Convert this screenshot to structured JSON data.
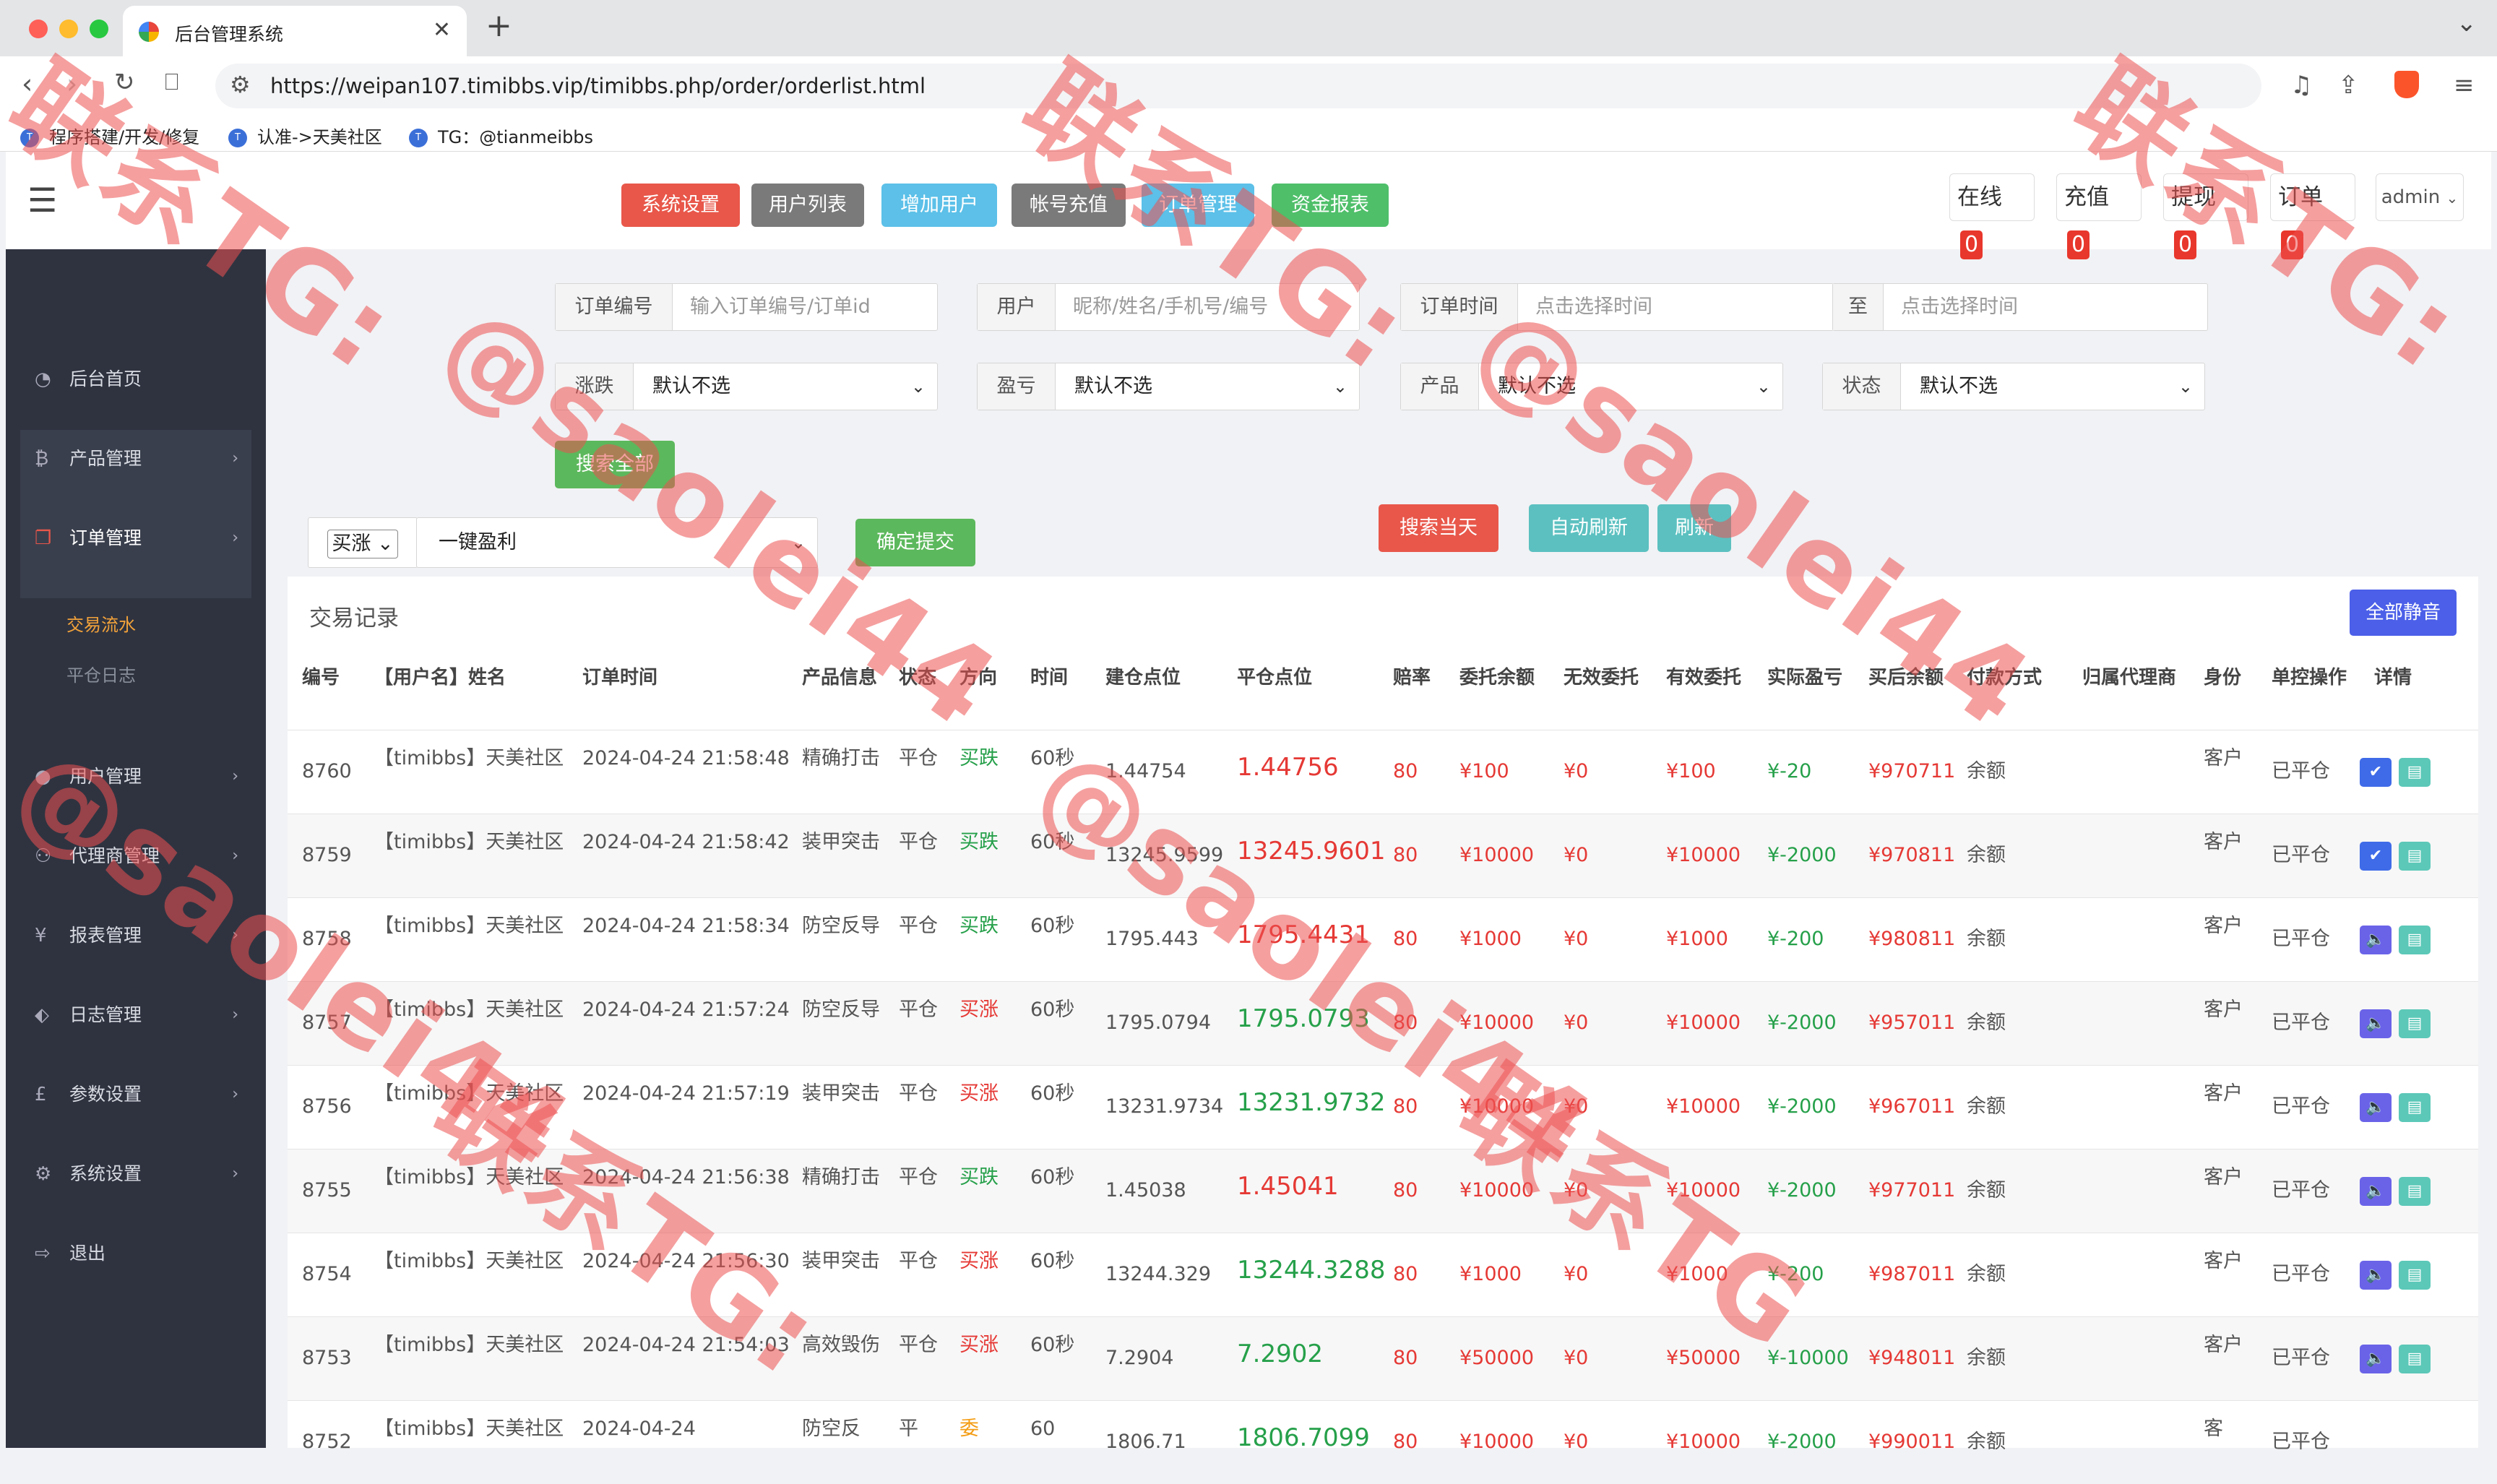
{
  "browser": {
    "tab_title": "后台管理系统",
    "tab_close": "✕",
    "new_tab": "+",
    "url": "https://weipan107.timibbs.vip/timibbs.php/order/orderlist.html",
    "bookmarks": [
      "程序搭建/开发/修复",
      "认准->天美社区",
      "TG：@tianmeibbs"
    ]
  },
  "topnav": {
    "buttons": [
      "系统设置",
      "用户列表",
      "增加用户",
      "帐号充值",
      "订单管理",
      "资金报表"
    ],
    "button_colors": [
      "#e8574a",
      "#7a7a7a",
      "#5cc0e8",
      "#7a7a7a",
      "#5cc0e8",
      "#4fbf6a"
    ],
    "stats": [
      {
        "label": "在线",
        "count": "0"
      },
      {
        "label": "充值",
        "count": "0"
      },
      {
        "label": "提现",
        "count": "0"
      },
      {
        "label": "订单",
        "count": "0"
      }
    ],
    "admin": "admin"
  },
  "sidebar": {
    "items": [
      {
        "label": "后台首页",
        "icon": "dashboard-icon",
        "glyph": "◔"
      },
      {
        "label": "产品管理",
        "icon": "bitcoin-icon",
        "glyph": "₿"
      },
      {
        "label": "订单管理",
        "icon": "copy-icon",
        "glyph": "❐"
      },
      {
        "label": "用户管理",
        "icon": "user-icon",
        "glyph": "●"
      },
      {
        "label": "代理商管理",
        "icon": "sitemap-icon",
        "glyph": "⚇"
      },
      {
        "label": "报表管理",
        "icon": "yen-icon",
        "glyph": "¥"
      },
      {
        "label": "日志管理",
        "icon": "tag-icon",
        "glyph": "⬖"
      },
      {
        "label": "参数设置",
        "icon": "pound-icon",
        "glyph": "£"
      },
      {
        "label": "系统设置",
        "icon": "gears-icon",
        "glyph": "⚙"
      },
      {
        "label": "退出",
        "icon": "signout-icon",
        "glyph": "⇨"
      }
    ],
    "submenu": [
      "交易流水",
      "平仓日志"
    ]
  },
  "filters": {
    "order_no": {
      "label": "订单编号",
      "placeholder": "输入订单编号/订单id"
    },
    "user": {
      "label": "用户",
      "placeholder": "昵称/姓名/手机号/编号"
    },
    "order_time": {
      "label": "订单时间",
      "placeholder": "点击选择时间"
    },
    "to": {
      "label": "至",
      "placeholder": "点击选择时间"
    },
    "rise_fall": {
      "label": "涨跌",
      "value": "默认不选"
    },
    "profit": {
      "label": "盈亏",
      "value": "默认不选"
    },
    "product": {
      "label": "产品",
      "value": "默认不选"
    },
    "status": {
      "label": "状态",
      "value": "默认不选"
    },
    "search_all": "搜索全部"
  },
  "actions": {
    "direction_select": "买涨",
    "profit_select": "一键盈利",
    "submit": "确定提交",
    "search_today": "搜索当天",
    "auto_refresh": "自动刷新",
    "refresh": "刷新"
  },
  "table": {
    "title": "交易记录",
    "mute_all": "全部静音",
    "headers": [
      "编号",
      "【用户名】姓名",
      "订单时间",
      "产品信息",
      "状态",
      "方向",
      "时间",
      "建仓点位",
      "平仓点位",
      "赔率",
      "委托余额",
      "无效委托",
      "有效委托",
      "实际盈亏",
      "买后余额",
      "付款方式",
      "归属代理商",
      "身份",
      "单控操作",
      "详情"
    ],
    "rows": [
      {
        "id": "8760",
        "user": "【timibbs】天美社区",
        "time": "2024-04-24 21:58:48",
        "product": "精确打击",
        "status": "平仓",
        "dir": "买跌",
        "dur": "60秒",
        "open": "1.44754",
        "close": "1.44756",
        "close_color": "red",
        "odds": "80",
        "entrust": "¥100",
        "invalid": "¥0",
        "valid": "¥100",
        "pl": "¥-20",
        "balance": "¥970711",
        "pay": "余额",
        "agent": "",
        "role": "客户",
        "ctrl": "已平仓",
        "op": "check"
      },
      {
        "id": "8759",
        "user": "【timibbs】天美社区",
        "time": "2024-04-24 21:58:42",
        "product": "装甲突击",
        "status": "平仓",
        "dir": "买跌",
        "dur": "60秒",
        "open": "13245.9599",
        "close": "13245.9601",
        "close_color": "red",
        "odds": "80",
        "entrust": "¥10000",
        "invalid": "¥0",
        "valid": "¥10000",
        "pl": "¥-2000",
        "balance": "¥970811",
        "pay": "余额",
        "agent": "",
        "role": "客户",
        "ctrl": "已平仓",
        "op": "check"
      },
      {
        "id": "8758",
        "user": "【timibbs】天美社区",
        "time": "2024-04-24 21:58:34",
        "product": "防空反导",
        "status": "平仓",
        "dir": "买跌",
        "dur": "60秒",
        "open": "1795.443",
        "close": "1795.4431",
        "close_color": "red",
        "odds": "80",
        "entrust": "¥1000",
        "invalid": "¥0",
        "valid": "¥1000",
        "pl": "¥-200",
        "balance": "¥980811",
        "pay": "余额",
        "agent": "",
        "role": "客户",
        "ctrl": "已平仓",
        "op": "sound"
      },
      {
        "id": "8757",
        "user": "【timibbs】天美社区",
        "time": "2024-04-24 21:57:24",
        "product": "防空反导",
        "status": "平仓",
        "dir": "买涨",
        "dur": "60秒",
        "open": "1795.0794",
        "close": "1795.0793",
        "close_color": "green",
        "odds": "80",
        "entrust": "¥10000",
        "invalid": "¥0",
        "valid": "¥10000",
        "pl": "¥-2000",
        "balance": "¥957011",
        "pay": "余额",
        "agent": "",
        "role": "客户",
        "ctrl": "已平仓",
        "op": "sound"
      },
      {
        "id": "8756",
        "user": "【timibbs】天美社区",
        "time": "2024-04-24 21:57:19",
        "product": "装甲突击",
        "status": "平仓",
        "dir": "买涨",
        "dur": "60秒",
        "open": "13231.9734",
        "close": "13231.9732",
        "close_color": "green",
        "odds": "80",
        "entrust": "¥10000",
        "invalid": "¥0",
        "valid": "¥10000",
        "pl": "¥-2000",
        "balance": "¥967011",
        "pay": "余额",
        "agent": "",
        "role": "客户",
        "ctrl": "已平仓",
        "op": "sound"
      },
      {
        "id": "8755",
        "user": "【timibbs】天美社区",
        "time": "2024-04-24 21:56:38",
        "product": "精确打击",
        "status": "平仓",
        "dir": "买跌",
        "dur": "60秒",
        "open": "1.45038",
        "close": "1.45041",
        "close_color": "red",
        "odds": "80",
        "entrust": "¥10000",
        "invalid": "¥0",
        "valid": "¥10000",
        "pl": "¥-2000",
        "balance": "¥977011",
        "pay": "余额",
        "agent": "",
        "role": "客户",
        "ctrl": "已平仓",
        "op": "sound"
      },
      {
        "id": "8754",
        "user": "【timibbs】天美社区",
        "time": "2024-04-24 21:56:30",
        "product": "装甲突击",
        "status": "平仓",
        "dir": "买涨",
        "dur": "60秒",
        "open": "13244.329",
        "close": "13244.3288",
        "close_color": "green",
        "odds": "80",
        "entrust": "¥1000",
        "invalid": "¥0",
        "valid": "¥1000",
        "pl": "¥-200",
        "balance": "¥987011",
        "pay": "余额",
        "agent": "",
        "role": "客户",
        "ctrl": "已平仓",
        "op": "sound"
      },
      {
        "id": "8753",
        "user": "【timibbs】天美社区",
        "time": "2024-04-24 21:54:03",
        "product": "高效毁伤",
        "status": "平仓",
        "dir": "买涨",
        "dur": "60秒",
        "open": "7.2904",
        "close": "7.2902",
        "close_color": "green",
        "odds": "80",
        "entrust": "¥50000",
        "invalid": "¥0",
        "valid": "¥50000",
        "pl": "¥-10000",
        "balance": "¥948011",
        "pay": "余额",
        "agent": "",
        "role": "客户",
        "ctrl": "已平仓",
        "op": "sound"
      },
      {
        "id": "8752",
        "user": "【timibbs】天美社区",
        "time": "2024-04-24",
        "product": "防空反",
        "status": "平",
        "dir": "委",
        "dur": "60",
        "open": "1806.71",
        "close": "1806.7099",
        "close_color": "green",
        "odds": "80",
        "entrust": "¥10000",
        "invalid": "¥0",
        "valid": "¥10000",
        "pl": "¥-2000",
        "balance": "¥990011",
        "pay": "余额",
        "agent": "",
        "role": "客",
        "ctrl": "已平仓",
        "op": "none"
      }
    ]
  },
  "watermarks": [
    "联系TG:",
    "@saolei44",
    "联系TG:",
    "@saolei44",
    "联系TG:",
    "@saolei44",
    "联系TG:",
    "@saolei44",
    "联系TG"
  ]
}
